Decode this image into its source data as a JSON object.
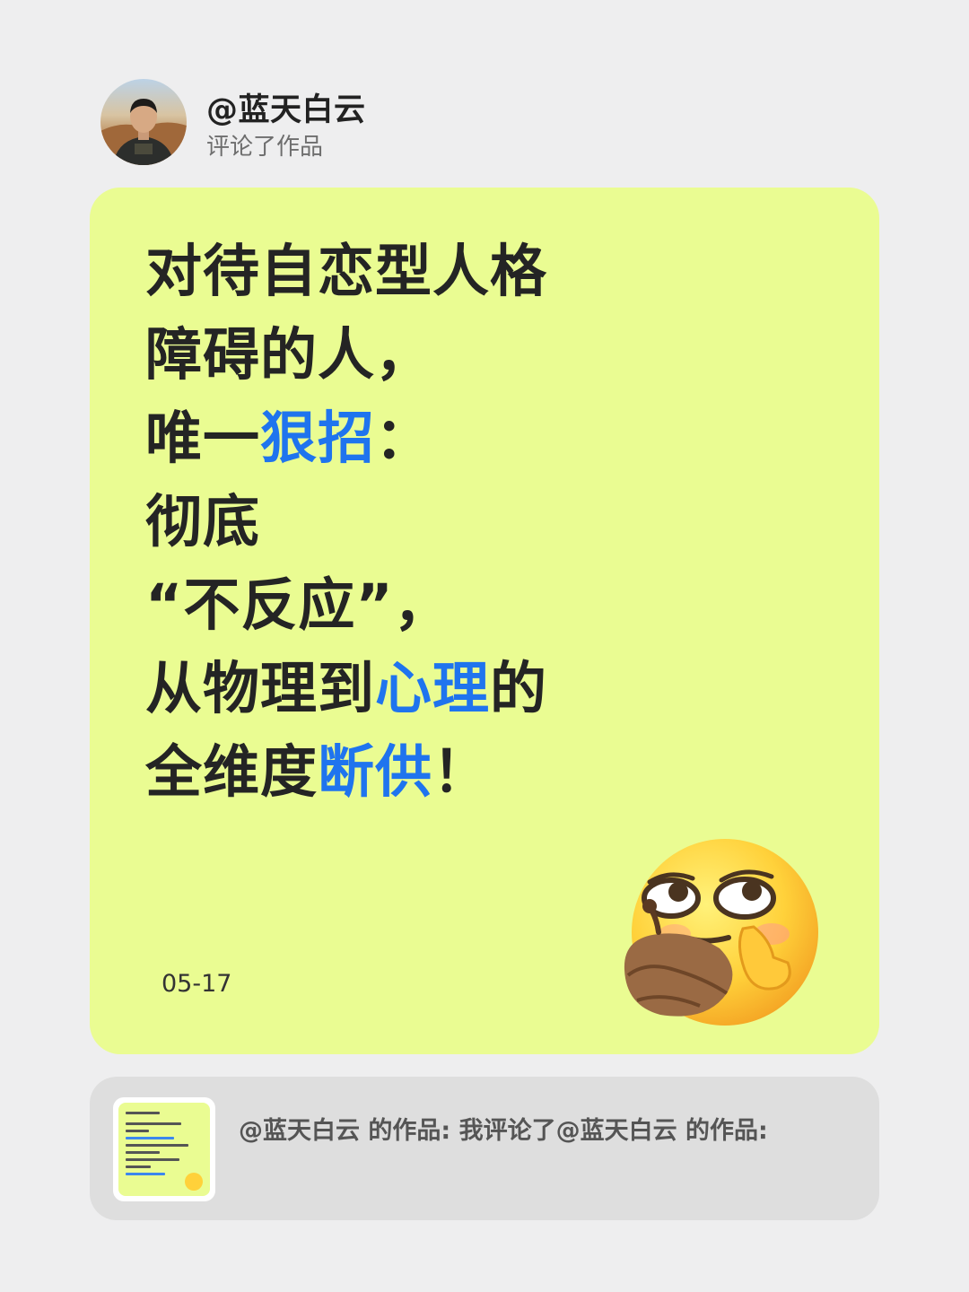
{
  "header": {
    "username": "@蓝天白云",
    "action": "评论了作品"
  },
  "card": {
    "background_color": "#eafc92",
    "accent_color": "#1f74ee",
    "headline_lines": [
      [
        {
          "text": "对待自恋型人格"
        }
      ],
      [
        {
          "text": "障碍的人，"
        }
      ],
      [
        {
          "text": "唯一"
        },
        {
          "text": "狠招",
          "accent": true
        },
        {
          "text": "："
        }
      ],
      [
        {
          "text": "彻底"
        }
      ],
      [
        {
          "text": "“不反应”，"
        }
      ],
      [
        {
          "text": "从物理到"
        },
        {
          "text": "心理",
          "accent": true
        },
        {
          "text": "的"
        }
      ],
      [
        {
          "text": "全维度"
        },
        {
          "text": "断供",
          "accent": true
        },
        {
          "text": "！"
        }
      ]
    ],
    "date": "05-17",
    "emoji_icon": "smirk-thinking-emoji-icon"
  },
  "reference": {
    "text": "@蓝天白云 的作品: 我评论了@蓝天白云 的作品:",
    "thumbnail_icon": "post-thumbnail-image"
  }
}
